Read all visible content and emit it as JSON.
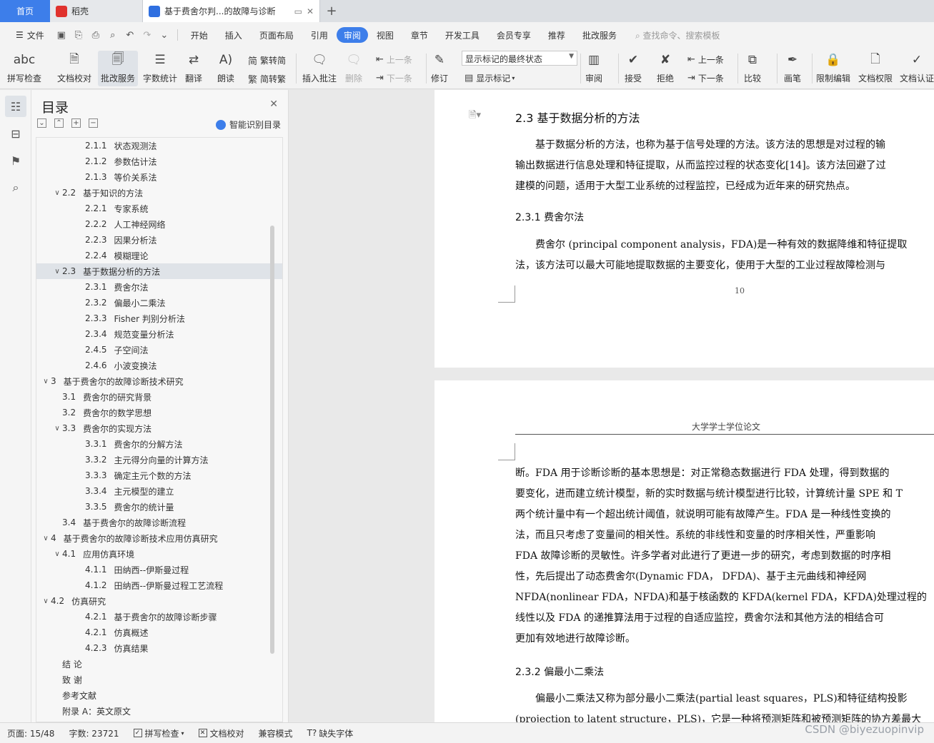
{
  "tabs": {
    "home": "首页",
    "daoke": "稻壳",
    "doc": "基于费舍尔判...的故障与诊断"
  },
  "menu": {
    "file": "文件",
    "items": [
      "开始",
      "插入",
      "页面布局",
      "引用",
      "审阅",
      "视图",
      "章节",
      "开发工具",
      "会员专享",
      "推荐",
      "批改服务"
    ],
    "active": "审阅",
    "search_placeholder": "查找命令、搜索模板"
  },
  "ribbon": {
    "spell": "拼写检查",
    "proofread": "文档校对",
    "review_service": "批改服务",
    "word_count": "字数统计",
    "translate": "翻译",
    "read_aloud": "朗读",
    "trad_to_simp": "繁转简",
    "simp_to_trad": "简转繁",
    "insert_comment": "插入批注",
    "delete": "删除",
    "prev": "上一条",
    "next": "下一条",
    "revise": "修订",
    "markup_state": "显示标记的最终状态",
    "show_markup": "显示标记",
    "review": "审阅",
    "accept": "接受",
    "reject": "拒绝",
    "prev2": "上一条",
    "next2": "下一条",
    "compare": "比较",
    "pen": "画笔",
    "restrict_edit": "限制编辑",
    "doc_perm": "文档权限",
    "doc_cert": "文档认证"
  },
  "toc": {
    "title": "目录",
    "smart": "智能识别目录",
    "items": [
      {
        "level": 3,
        "num": "2.1.1",
        "text": "状态观测法",
        "caret": ""
      },
      {
        "level": 3,
        "num": "2.1.2",
        "text": "参数估计法",
        "caret": ""
      },
      {
        "level": 3,
        "num": "2.1.3",
        "text": "等价关系法",
        "caret": ""
      },
      {
        "level": 2,
        "num": "2.2",
        "text": "基于知识的方法",
        "caret": "v"
      },
      {
        "level": 3,
        "num": "2.2.1",
        "text": "专家系统",
        "caret": ""
      },
      {
        "level": 3,
        "num": "2.2.2",
        "text": "人工神经网络",
        "caret": ""
      },
      {
        "level": 3,
        "num": "2.2.3",
        "text": "因果分析法",
        "caret": ""
      },
      {
        "level": 3,
        "num": "2.2.4",
        "text": "模糊理论",
        "caret": ""
      },
      {
        "level": 2,
        "num": "2.3",
        "text": "基于数据分析的方法",
        "caret": "v",
        "selected": true
      },
      {
        "level": 3,
        "num": "2.3.1",
        "text": "费舍尔法",
        "caret": ""
      },
      {
        "level": 3,
        "num": "2.3.2",
        "text": "偏最小二乘法",
        "caret": ""
      },
      {
        "level": 3,
        "num": "2.3.3",
        "text": "Fisher 判别分析法",
        "caret": ""
      },
      {
        "level": 3,
        "num": "2.3.4",
        "text": "规范变量分析法",
        "caret": ""
      },
      {
        "level": 3,
        "num": "2.4.5",
        "text": "子空间法",
        "caret": ""
      },
      {
        "level": 3,
        "num": "2.4.6",
        "text": "小波变换法",
        "caret": ""
      },
      {
        "level": 1,
        "num": "3",
        "text": "基于费舍尔的故障诊断技术研究",
        "caret": "v"
      },
      {
        "level": 2,
        "num": "3.1",
        "text": "费舍尔的研究背景",
        "caret": ""
      },
      {
        "level": 2,
        "num": "3.2",
        "text": "费舍尔的数学思想",
        "caret": ""
      },
      {
        "level": 2,
        "num": "3.3",
        "text": "费舍尔的实现方法",
        "caret": "v"
      },
      {
        "level": 3,
        "num": "3.3.1",
        "text": "费舍尔的分解方法",
        "caret": ""
      },
      {
        "level": 3,
        "num": "3.3.2",
        "text": "主元得分向量的计算方法",
        "caret": ""
      },
      {
        "level": 3,
        "num": "3.3.3",
        "text": "确定主元个数的方法",
        "caret": ""
      },
      {
        "level": 3,
        "num": "3.3.4",
        "text": "主元模型的建立",
        "caret": ""
      },
      {
        "level": 3,
        "num": "3.3.5",
        "text": "费舍尔的统计量",
        "caret": ""
      },
      {
        "level": 2,
        "num": "3.4",
        "text": "基于费舍尔的故障诊断流程",
        "caret": ""
      },
      {
        "level": 1,
        "num": "4",
        "text": "基于费舍尔的故障诊断技术应用仿真研究",
        "caret": "v"
      },
      {
        "level": 2,
        "num": "4.1",
        "text": "应用仿真环境",
        "caret": "v"
      },
      {
        "level": 3,
        "num": "4.1.1",
        "text": "田纳西--伊斯曼过程",
        "caret": ""
      },
      {
        "level": 3,
        "num": "4.1.2",
        "text": "田纳西--伊斯曼过程工艺流程",
        "caret": ""
      },
      {
        "level": 1,
        "num": "4.2",
        "text": "仿真研究",
        "caret": "v"
      },
      {
        "level": 3,
        "num": "4.2.1",
        "text": "基于费舍尔的故障诊断步骤",
        "caret": ""
      },
      {
        "level": 3,
        "num": "4.2.1",
        "text": "仿真概述",
        "caret": ""
      },
      {
        "level": 3,
        "num": "4.2.3",
        "text": "仿真结果",
        "caret": ""
      },
      {
        "level": 0,
        "num": "",
        "text": "结 论",
        "caret": ""
      },
      {
        "level": 0,
        "num": "",
        "text": "致 谢",
        "caret": ""
      },
      {
        "level": 0,
        "num": "",
        "text": "参考文献",
        "caret": ""
      },
      {
        "level": 0,
        "num": "",
        "text": "附录 A：英文原文",
        "caret": ""
      }
    ]
  },
  "document": {
    "page1": {
      "heading": "2.3    基于数据分析的方法",
      "para1": [
        "　　基于数据分析的方法，也称为基于信号处理的方法。该方法的思想是对过程的输",
        "输出数据进行信息处理和特征提取，从而监控过程的状态变化[14]。该方法回避了过",
        "建模的问题，适用于大型工业系统的过程监控，已经成为近年来的研究热点。"
      ],
      "subheading": "2.3.1    费舍尔法",
      "para2": [
        "　　费舍尔 (principal component analysis，FDA)是一种有效的数据降维和特征提取",
        "法，该方法可以最大可能地提取数据的主要变化，使用于大型的工业过程故障检测与"
      ],
      "page_number": "10"
    },
    "page2": {
      "header": "大学学士学位论文",
      "para1": [
        "断。FDA 用于诊断诊断的基本思想是：对正常稳态数据进行 FDA 处理，得到数据的",
        "要变化，进而建立统计模型，新的实时数据与统计模型进行比较，计算统计量 SPE 和 T",
        "两个统计量中有一个超出统计阈值，就说明可能有故障产生。FDA 是一种线性变换的",
        "法，而且只考虑了变量间的相关性。系统的非线性和变量的时序相关性，严重影响",
        "FDA 故障诊断的灵敏性。许多学者对此进行了更进一步的研究，考虑到数据的时序相",
        "性，先后提出了动态费舍尔(Dynamic FDA， DFDA)、基于主元曲线和神经网",
        "NFDA(nonlinear FDA，NFDA)和基于核函数的 KFDA(kernel FDA，KFDA)处理过程的",
        "线性以及 FDA 的递推算法用于过程的自适应监控，费舍尔法和其他方法的相结合可",
        "更加有效地进行故障诊断。"
      ],
      "subheading": "2.3.2    偏最小二乘法",
      "para2": [
        "　　偏最小二乘法又称为部分最小二乘法(partial least squares，PLS)和特征结构投影",
        "(projection to latent structure，PLS)，它是一种将预测矩阵和被预测矩阵的协方差最大"
      ]
    }
  },
  "status": {
    "page": "页面: 15/48",
    "words": "字数: 23721",
    "spell": "拼写检查",
    "proof": "文档校对",
    "compat": "兼容模式",
    "missing_font": "缺失字体"
  },
  "watermark": "CSDN @biyezuopinvip"
}
